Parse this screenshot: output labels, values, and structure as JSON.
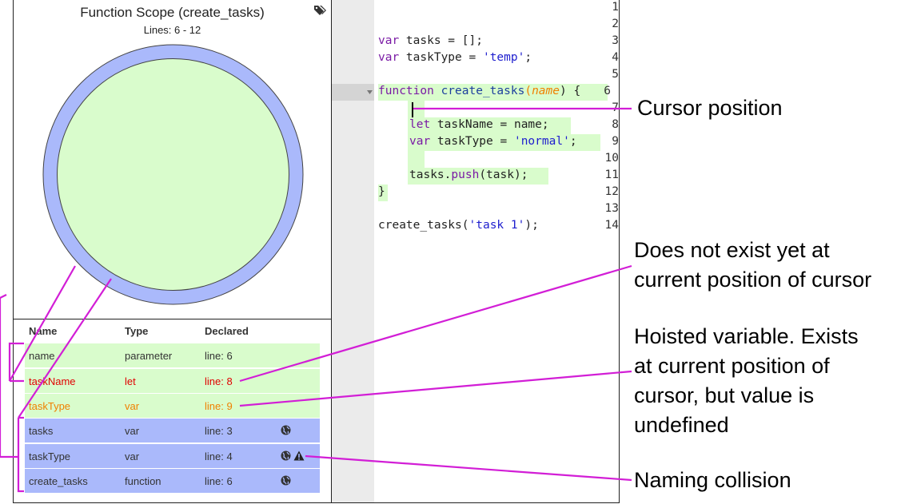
{
  "scope_panel": {
    "title": "Function Scope (create_tasks)",
    "lines": "Lines: 6 - 12",
    "tag_icon": "tags-icon"
  },
  "table": {
    "headers": {
      "name": "Name",
      "type": "Type",
      "declared": "Declared"
    },
    "rows": [
      {
        "name": "name",
        "type": "parameter",
        "declared": "line: 6"
      },
      {
        "name": "taskName",
        "type": "let",
        "declared": "line: 8"
      },
      {
        "name": "taskType",
        "type": "var",
        "declared": "line: 9"
      },
      {
        "name": "tasks",
        "type": "var",
        "declared": "line: 3",
        "icons": [
          "globe-icon"
        ]
      },
      {
        "name": "taskType",
        "type": "var",
        "declared": "line: 4",
        "icons": [
          "globe-icon",
          "warning-icon"
        ]
      },
      {
        "name": "create_tasks",
        "type": "function",
        "declared": "line: 6",
        "icons": [
          "globe-icon"
        ]
      }
    ]
  },
  "editor": {
    "line_numbers": [
      "1",
      "2",
      "3",
      "4",
      "5",
      "6",
      "7",
      "8",
      "9",
      "10",
      "11",
      "12",
      "13",
      "14"
    ],
    "code": {
      "l3_kw": "var",
      "l3_rest": " tasks = [];",
      "l4_kw": "var",
      "l4_rest": " taskType = ",
      "l4_str": "'temp'",
      "l4_end": ";",
      "l6_kw": "function",
      "l6_fn": " create_tasks",
      "l6_open": "(",
      "l6_param": "name",
      "l6_close": ") {",
      "l8_kw": "let",
      "l8_rest": " taskName = name;",
      "l9_kw": "var",
      "l9_rest": " taskType = ",
      "l9_str": "'normal'",
      "l9_end": ";",
      "l11_a": "tasks.",
      "l11_fn": "push",
      "l11_b": "(task);",
      "l12": "}",
      "l14_a": "create_tasks(",
      "l14_str": "'task 1'",
      "l14_b": ");"
    }
  },
  "annotations": {
    "cursor": "Cursor position",
    "not_exist_1": "Does not exist yet at",
    "not_exist_2": "current position of cursor",
    "hoisted_1": "Hoisted variable. Exists",
    "hoisted_2": "at current position of",
    "hoisted_3": "cursor, but value is",
    "hoisted_4": "undefined",
    "collision": "Naming collision"
  },
  "colors": {
    "local_scope": "#d9fccc",
    "global_scope": "#aab9fb",
    "not_yet_declared": "#e00000",
    "hoisted": "#f08000",
    "annotation_line": "#d21ed6"
  }
}
